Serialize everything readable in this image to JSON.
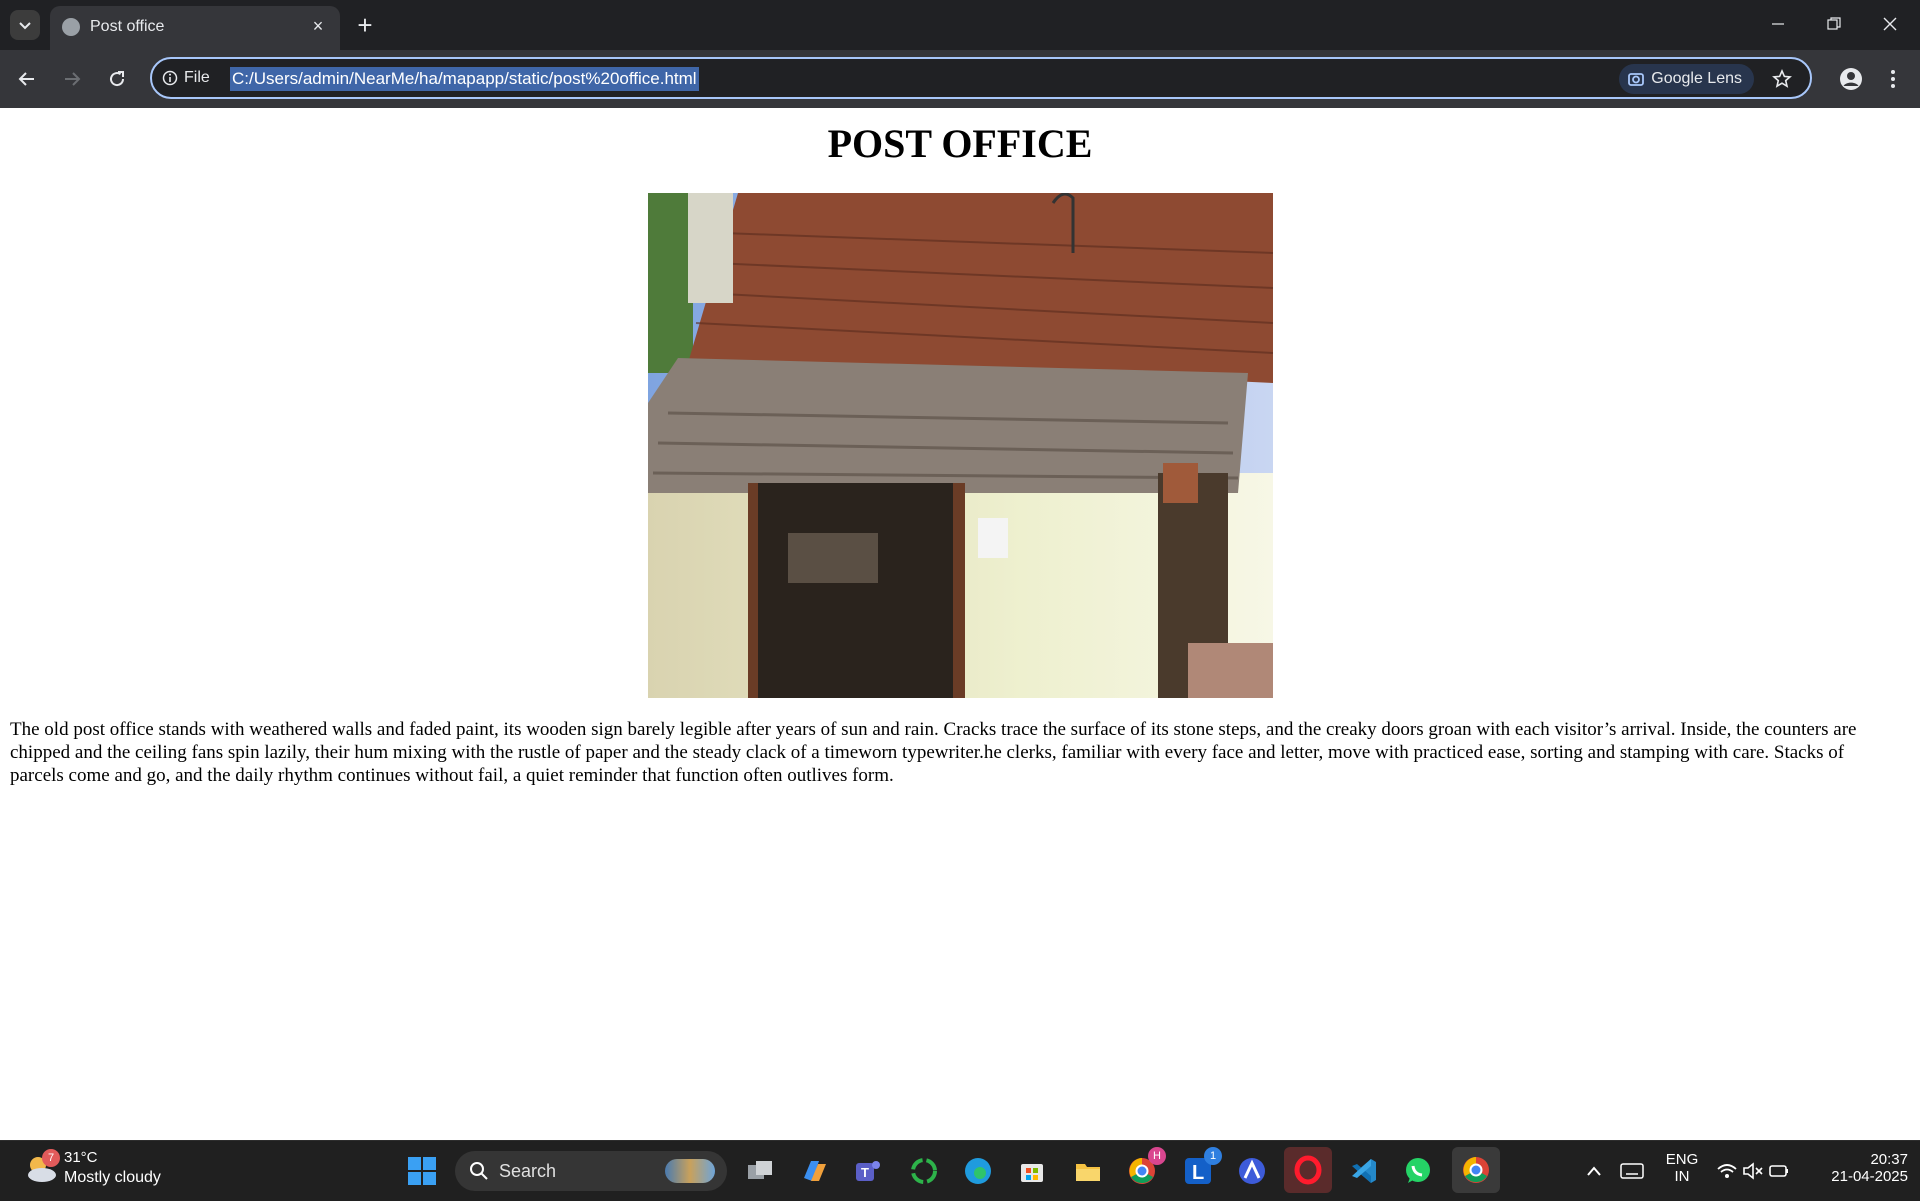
{
  "tab": {
    "title": "Post office",
    "close_glyph": "×",
    "new_glyph": "+"
  },
  "omnibox": {
    "scheme_label": "File",
    "url": "C:/Users/admin/NearMe/ha/mapapp/static/post%20office.html",
    "lens_label": "Google Lens"
  },
  "page": {
    "heading": "POST OFFICE",
    "description": "The old post office stands with weathered walls and faded paint, its wooden sign barely legible after years of sun and rain. Cracks trace the surface of its stone steps, and the creaky doors groan with each visitor’s arrival. Inside, the counters are chipped and the ceiling fans spin lazily, their hum mixing with the rustle of paper and the steady clack of a timeworn typewriter.he clerks, familiar with every face and letter, move with practiced ease, sorting and stamping with care. Stacks of parcels come and go, and the daily rhythm continues without fail, a quiet reminder that function often outlives form."
  },
  "taskbar": {
    "weather_temp": "31°C",
    "weather_desc": "Mostly cloudy",
    "weather_badge": "7",
    "search_label": "Search",
    "chrome_badge": "H",
    "l_badge": "1",
    "lang_top": "ENG",
    "lang_bottom": "IN",
    "time": "20:37",
    "date": "21-04-2025"
  },
  "colors": {
    "accent": "#a8c7fa",
    "chrome_dark": "#202124",
    "toolbar": "#35363a"
  }
}
